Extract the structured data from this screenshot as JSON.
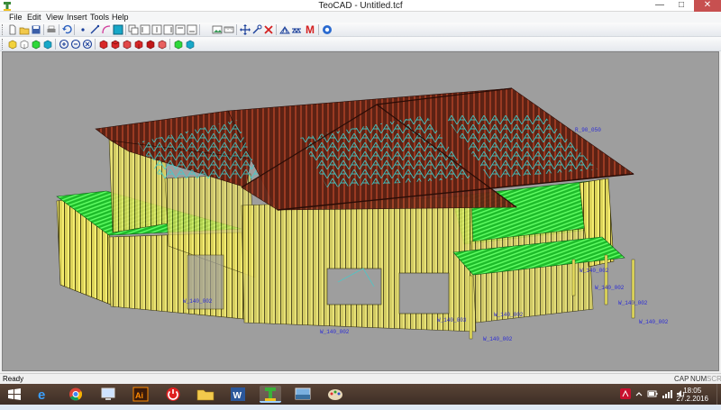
{
  "window": {
    "title": "TeoCAD - Untitled.tcf",
    "controls": {
      "minimize": "—",
      "maximize": "□",
      "close": "✕"
    }
  },
  "menu": [
    "File",
    "Edit",
    "View",
    "Insert",
    "Tools",
    "Help"
  ],
  "toolbar1": {
    "icons": [
      "new-file-icon",
      "open-file-icon",
      "save-icon",
      "print-icon",
      "undo-icon",
      "point-icon",
      "line-icon",
      "arc-icon",
      "rectangle-icon",
      "copy-icon",
      "align-left-icon",
      "align-center-icon",
      "align-right-icon",
      "align-top-icon",
      "align-bottom-icon",
      "image-icon",
      "measure-icon",
      "move-icon",
      "pan-icon",
      "delete-icon",
      "truss-icon",
      "truss-alt-icon",
      "m-icon",
      "help-icon"
    ],
    "m_label": "M"
  },
  "toolbar2": {
    "icons": [
      "view-front-icon",
      "view-side-icon",
      "view-iso-icon",
      "view-top-icon",
      "zoom-in-icon",
      "zoom-out-icon",
      "zoom-extents-icon",
      "box-red-1-icon",
      "box-red-2-icon",
      "box-red-3-icon",
      "box-red-4-icon",
      "box-red-5-icon",
      "box-red-6-icon",
      "box-green-icon",
      "box-cyan-icon"
    ]
  },
  "labels": [
    {
      "text": "R_90_050"
    },
    {
      "text": "W_140_002"
    },
    {
      "text": "W_140_002"
    },
    {
      "text": "W_140_002"
    },
    {
      "text": "W_140_002"
    },
    {
      "text": "W_140_002"
    },
    {
      "text": "W_140_003"
    },
    {
      "text": "W_140_002"
    },
    {
      "text": "W_140_002"
    },
    {
      "text": "W_140_002"
    }
  ],
  "status": {
    "text": "Ready",
    "indicators": [
      {
        "label": "CAP",
        "active": true
      },
      {
        "label": "NUM",
        "active": true
      },
      {
        "label": "SCRL",
        "active": false
      }
    ]
  },
  "taskbar": {
    "apps": [
      "start-icon",
      "ie-icon",
      "chrome-icon",
      "remote-desktop-icon",
      "illustrator-icon",
      "power-icon",
      "file-explorer-icon",
      "word-icon",
      "teocad-icon",
      "photos-icon",
      "paint-icon"
    ],
    "active_app": "teocad-icon",
    "clock_time": "18:05",
    "clock_date": "27.2.2016",
    "colors": {
      "taskbar": "#4a382e",
      "accent": "#9fd0ff"
    }
  },
  "colors": {
    "viewport_bg": "#9e9e9e",
    "wall_frame": "#f0e860",
    "roof": "#7a2a1a",
    "truss": "#3ad0d0",
    "deck": "#2ed83a",
    "label": "#2b2bd6"
  }
}
